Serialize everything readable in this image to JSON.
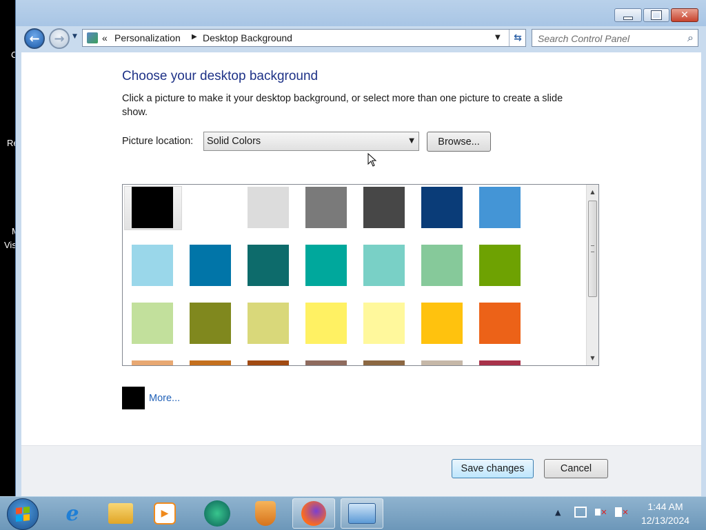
{
  "window": {
    "title_buttons": {
      "minimize_icon": "minimize-icon",
      "maximize_icon": "maximize-icon",
      "close_icon": "close-icon",
      "close_glyph": "✕"
    }
  },
  "nav": {
    "breadcrumb": {
      "prefix": "«",
      "items": [
        "Personalization",
        "Desktop Background"
      ],
      "separator": "▶"
    },
    "search_placeholder": "Search Control Panel"
  },
  "page": {
    "heading": "Choose your desktop background",
    "description": "Click a picture to make it your desktop background, or select more than one picture to create a slide show.",
    "picture_location_label": "Picture location:",
    "picture_location_value": "Solid Colors",
    "browse_label": "Browse...",
    "swatches": [
      "#000000",
      "#ffffff",
      "#dcdcdc",
      "#7a7a7a",
      "#474747",
      "#0a3c78",
      "#4495d6",
      "#9ad7ea",
      "#0175a8",
      "#0d6b6b",
      "#00a89c",
      "#79d0c6",
      "#86c99a",
      "#6ea202",
      "#c2e09c",
      "#80881e",
      "#d9d87a",
      "#fff163",
      "#fff89c",
      "#ffc20e",
      "#ec6218",
      "#e8a872",
      "#c4701e",
      "#a14a12",
      "#8f6b5e",
      "#8c6842",
      "#c6b8a8",
      "#a8324a"
    ],
    "selected_swatch": 0,
    "more_color": "#000000",
    "more_label": "More...",
    "save_label": "Save changes",
    "cancel_label": "Cancel"
  },
  "desktop": {
    "labels": [
      "C",
      "Re",
      "M",
      "Vis"
    ]
  },
  "taskbar": {
    "apps": [
      {
        "name": "internet-explorer-icon"
      },
      {
        "name": "file-explorer-icon"
      },
      {
        "name": "media-player-icon"
      },
      {
        "name": "chat-app-icon"
      },
      {
        "name": "shield-app-icon"
      },
      {
        "name": "firefox-icon"
      },
      {
        "name": "control-panel-icon"
      }
    ],
    "clock": {
      "time": "1:44 AM",
      "date": "12/13/2024"
    }
  }
}
